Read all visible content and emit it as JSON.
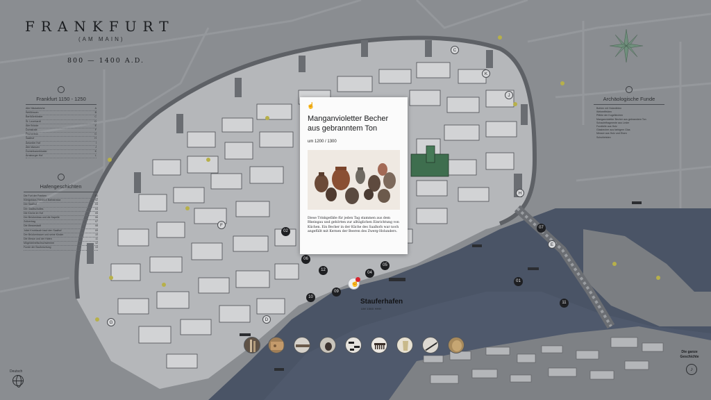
{
  "header": {
    "title": "FRANKFURT",
    "subtitle": "(AM MAIN)",
    "era": "800 — 1400 A.D."
  },
  "panels": {
    "frankfurt": {
      "title": "Frankfurt 1150 - 1250",
      "items": [
        {
          "label": "Alte Nikolaikirche",
          "ref": "A"
        },
        {
          "label": "Weißfrauen",
          "ref": "B"
        },
        {
          "label": "Barfüßerkloster",
          "ref": "C"
        },
        {
          "label": "St. Leonhardt",
          "ref": "D"
        },
        {
          "label": "Alte Brücke",
          "ref": "E"
        },
        {
          "label": "Domstrafe",
          "ref": "F"
        },
        {
          "label": "Fischerfeld",
          "ref": "G"
        },
        {
          "label": "Saalhof",
          "ref": "H"
        },
        {
          "label": "Antoniter Hof",
          "ref": "I"
        },
        {
          "label": "Alte Mainzer",
          "ref": "J"
        },
        {
          "label": "Dominikanerkloster",
          "ref": "K"
        },
        {
          "label": "Arnsburger Hof",
          "ref": "L"
        }
      ]
    },
    "hafen": {
      "title": "Hafengeschichten",
      "items": [
        {
          "label": "Die Furt der Franken",
          "ref": "01"
        },
        {
          "label": "Königshaus Friedrich Barbarossa",
          "ref": "02"
        },
        {
          "label": "Der Saalhof",
          "ref": "03"
        },
        {
          "label": "Der Stadtschultes",
          "ref": "04"
        },
        {
          "label": "Die Kirche im Hof",
          "ref": "05"
        },
        {
          "label": "Der Brückenbau und die Kapelle",
          "ref": "06"
        },
        {
          "label": "Zollvertrag",
          "ref": "07"
        },
        {
          "label": "Die Messestadt",
          "ref": "08"
        },
        {
          "label": "Joliot Knoblauch baut den Saalhof",
          "ref": "09"
        },
        {
          "label": "Der Brückenbauer und seine Kinder",
          "ref": "10"
        },
        {
          "label": "Die Messe und der Hafen",
          "ref": "11"
        },
        {
          "label": "Mögeldeinetischschwemme",
          "ref": "12"
        },
        {
          "label": "Funde der Bauforschung",
          "ref": "13"
        }
      ]
    },
    "funde": {
      "title": "Archäologische Funde",
      "items": [
        "Bohlen mit Holznähten",
        "Webeeffekten",
        "Pfähle der Kugelkirchen",
        "Manganvioletter Becher aus gebranntem Ton",
        "Schaufelfragmente aus Leder",
        "Fundteile aus Holz",
        "Glasbecher aus farbigem Glas",
        "Messer aus Holz und Eisen",
        "Schuhleisten"
      ]
    }
  },
  "pins": {
    "numbers": [
      "01",
      "02",
      "04",
      "05",
      "06",
      "07",
      "09",
      "10",
      "11",
      "12"
    ],
    "letters": [
      "C",
      "D",
      "E",
      "F",
      "G",
      "H",
      "J",
      "K"
    ]
  },
  "location": {
    "name": "Stauferhafen",
    "sub": "UM 1060 HHH"
  },
  "card": {
    "title": "Manganvioletter Becher aus gebranntem Ton",
    "date": "um 1200 / 1300",
    "text": "Diese Trinkgefäße für jeden Tag stammen aus dem Rheingau und gehörten zur alltäglichen Einrichtung von Küchen. Ein Becher in der Küche des Saalhofs war noch angefüllt mit Kernen der Beeren des Zwerg-Holunders."
  },
  "thumbnails": [
    "Pfähle",
    "Bohlen",
    "Webeeffekten",
    "Becher",
    "Holzreste",
    "Kamm",
    "Glas",
    "Messer",
    "Leder"
  ],
  "footer": {
    "language": "Deutsch",
    "story_label": "Die ganze Geschichte"
  },
  "colors": {
    "background": "#8a8d91",
    "river": "#4a5466",
    "accent_red": "#d7262f",
    "card": "#fbfbfb"
  }
}
